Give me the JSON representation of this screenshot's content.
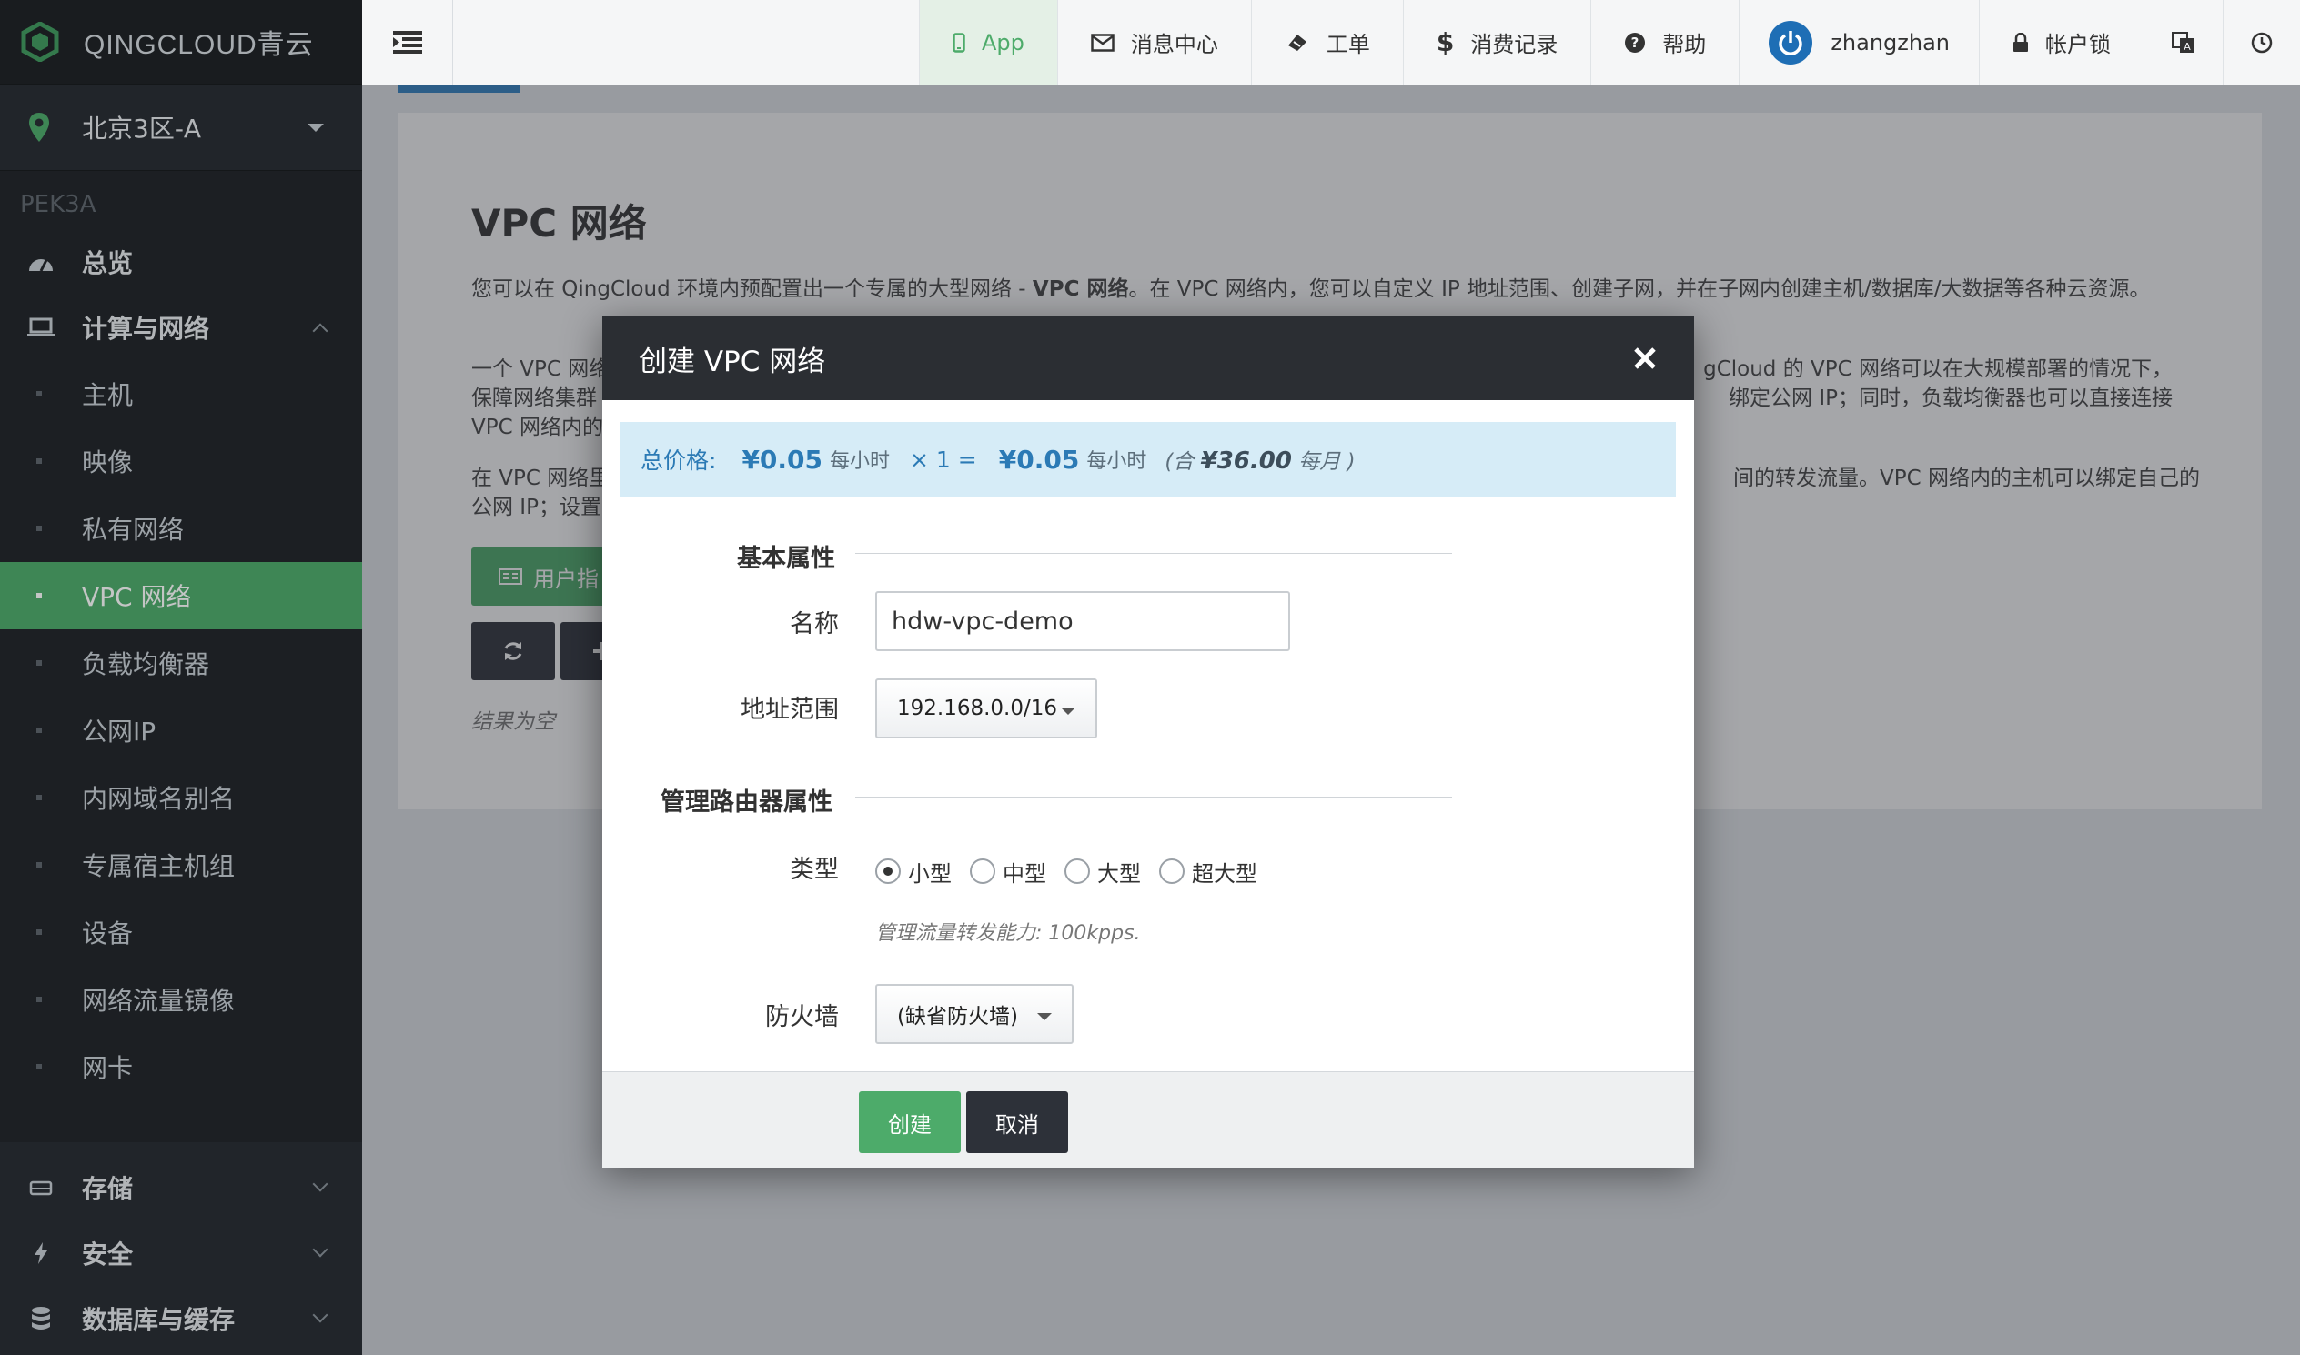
{
  "sidebar": {
    "brand": "QINGCLOUD青云",
    "zone": "北京3区-A",
    "region_code": "PEK3A",
    "overview": "总览",
    "compute_group": "计算与网络",
    "items": [
      {
        "label": "主机"
      },
      {
        "label": "映像"
      },
      {
        "label": "私有网络"
      },
      {
        "label": "VPC 网络"
      },
      {
        "label": "负载均衡器"
      },
      {
        "label": "公网IP"
      },
      {
        "label": "内网域名别名"
      },
      {
        "label": "专属宿主机组"
      },
      {
        "label": "设备"
      },
      {
        "label": "网络流量镜像"
      },
      {
        "label": "网卡"
      }
    ],
    "active_item": "VPC 网络",
    "bottom_groups": [
      {
        "label": "存储"
      },
      {
        "label": "安全"
      },
      {
        "label": "数据库与缓存"
      }
    ]
  },
  "topbar": {
    "app": "App",
    "messages": "消息中心",
    "tickets": "工单",
    "billing": "消费记录",
    "help": "帮助",
    "user": "zhangzhan",
    "account_lock": "帐户锁"
  },
  "page": {
    "title": "VPC 网络",
    "para1_a": "您可以在 QingCloud 环境内预配置出一个专属的大型网络 - ",
    "para1_b": "VPC 网络",
    "para1_c": "。在 VPC 网络内，您可以自定义 IP 地址范围、创建子网，并在子网内创建主机/数据库/大数据等各种云资源。",
    "para2": "一个 VPC 网络",
    "para2_right": "gCloud 的 VPC 网络可以在大规模部署的情况下，",
    "para2_line2": "保障网络集群",
    "para2_line2_right": "绑定公网 IP；同时，负载均衡器也可以直接连接",
    "para2_line3": "VPC 网络内的",
    "para3": "在 VPC 网络里",
    "para3_right": "间的转发流量。VPC 网络内的主机可以绑定自己的",
    "para3_line2": "公网 IP；设置",
    "guide_button": "用户指",
    "empty_text": "结果为空"
  },
  "modal": {
    "title": "创建 VPC 网络",
    "price": {
      "label": "总价格:",
      "unit_price": "¥0.05",
      "per_hour": "每小时",
      "multiplier": "× 1 =",
      "total": "¥0.05",
      "per_hour2": "每小时",
      "monthly_prefix": "(合",
      "monthly_value": "¥36.00",
      "monthly_suffix": "每月 )"
    },
    "section_basic": "基本属性",
    "name_label": "名称",
    "name_value": "hdw-vpc-demo",
    "range_label": "地址范围",
    "range_value": "192.168.0.0/16",
    "section_router": "管理路由器属性",
    "type_label": "类型",
    "type_options": [
      "小型",
      "中型",
      "大型",
      "超大型"
    ],
    "type_selected": "小型",
    "capacity_note": "管理流量转发能力:   100kpps.",
    "firewall_label": "防火墙",
    "firewall_value": "(缺省防火墙)",
    "create_button": "创建",
    "cancel_button": "取消"
  },
  "colors": {
    "accent_green": "#4dab6a",
    "sidebar_bg": "#1f2227",
    "modal_header": "#2b2e33",
    "price_bg": "#d6ecf7",
    "price_text": "#2b7ab5"
  }
}
